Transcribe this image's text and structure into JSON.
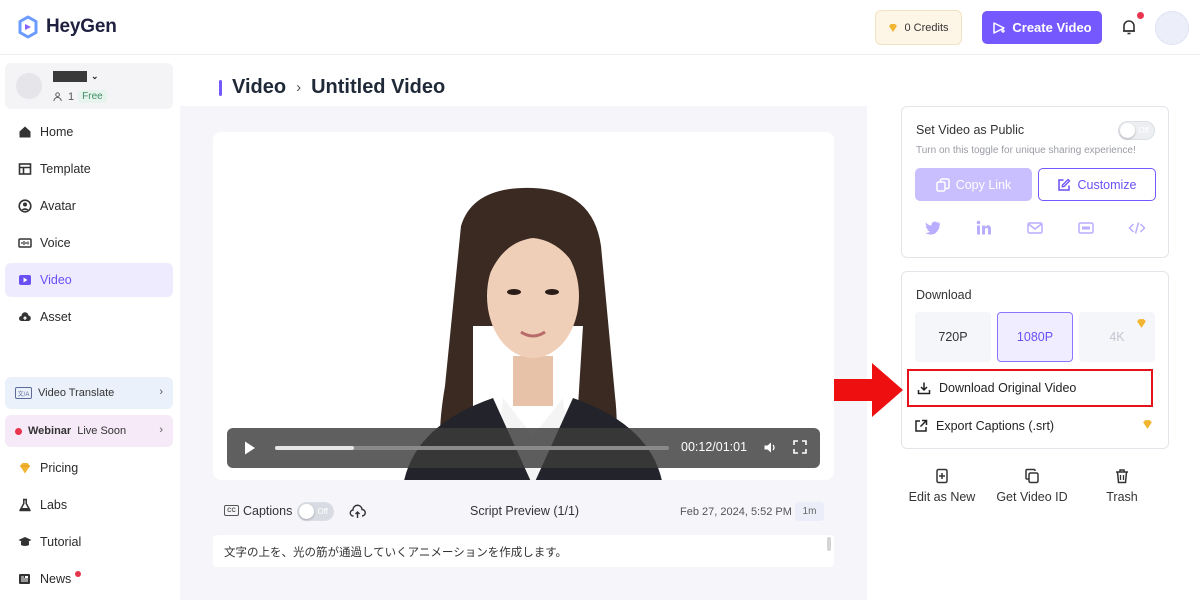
{
  "app": {
    "name": "HeyGen"
  },
  "header": {
    "credits_label": "0 Credits",
    "create_label": "Create Video",
    "notification_badge": true
  },
  "workspace": {
    "member_count": "1",
    "plan": "Free"
  },
  "sidebar": {
    "items": [
      {
        "label": "Home",
        "icon": "home-icon"
      },
      {
        "label": "Template",
        "icon": "template-icon"
      },
      {
        "label": "Avatar",
        "icon": "avatar-icon"
      },
      {
        "label": "Voice",
        "icon": "voice-icon"
      },
      {
        "label": "Video",
        "icon": "video-icon",
        "active": true
      },
      {
        "label": "Asset",
        "icon": "cloud-icon"
      }
    ],
    "promo_translate": "Video Translate",
    "promo_webinar_bold": "Webinar",
    "promo_webinar_rest": "Live Soon",
    "lower_items": [
      {
        "label": "Pricing",
        "icon": "gem-icon"
      },
      {
        "label": "Labs",
        "icon": "flask-icon"
      },
      {
        "label": "Tutorial",
        "icon": "graduation-cap-icon"
      },
      {
        "label": "News",
        "icon": "news-icon",
        "badge": true
      }
    ]
  },
  "breadcrumb": {
    "root": "Video",
    "separator": "›",
    "current": "Untitled Video"
  },
  "player": {
    "time": "00:12/01:01",
    "progress": 0.2
  },
  "captions": {
    "label": "Captions",
    "toggle": "Off",
    "script_preview": "Script Preview (1/1)",
    "date": "Feb 27, 2024, 5:52 PM",
    "duration": "1m"
  },
  "script": {
    "text": "文字の上を、光の筋が通過していくアニメーションを作成します。"
  },
  "share": {
    "title": "Set Video as Public",
    "toggle": "Off",
    "hint": "Turn on this toggle for unique sharing experience!",
    "copy_label": "Copy Link",
    "customize_label": "Customize",
    "socials": [
      "twitter-icon",
      "linkedin-icon",
      "mail-icon",
      "gif-icon",
      "embed-code-icon"
    ]
  },
  "download": {
    "title": "Download",
    "resolutions": [
      {
        "label": "720P",
        "state": "default"
      },
      {
        "label": "1080P",
        "state": "selected"
      },
      {
        "label": "4K",
        "state": "locked"
      }
    ],
    "original_label": "Download Original Video",
    "captions_label": "Export Captions (.srt)"
  },
  "actions": {
    "edit_label": "Edit as New",
    "id_label": "Get Video ID",
    "trash_label": "Trash"
  },
  "colors": {
    "accent": "#7559ff",
    "highlight": "#e5121b",
    "gem": "#f2b531"
  }
}
